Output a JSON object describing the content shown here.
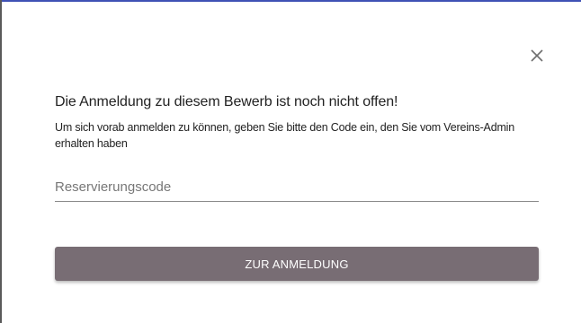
{
  "dialog": {
    "close_icon": "close-icon",
    "heading": "Die Anmeldung zu diesem Bewerb ist noch nicht offen!",
    "subtext": "Um sich vorab anmelden zu können, geben Sie bitte den Code ein, den Sie vom Vereins-Admin erhalten haben",
    "code_input": {
      "placeholder": "Reservierungscode",
      "value": ""
    },
    "submit_label": "ZUR ANMELDUNG"
  },
  "colors": {
    "button_bg": "#786d74",
    "button_text": "#ffffff",
    "top_border": "#3f51b5"
  }
}
